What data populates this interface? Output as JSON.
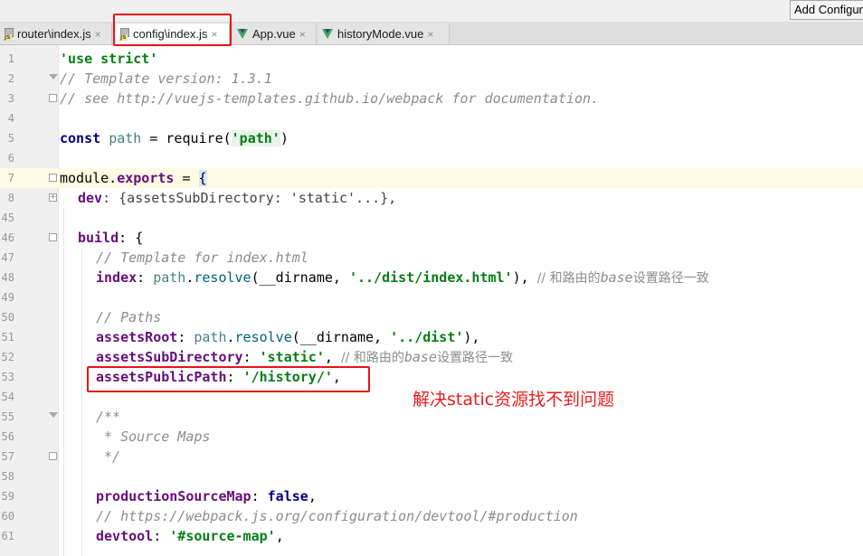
{
  "toolbar": {
    "run_config_label": "Add Configur"
  },
  "tabs": [
    {
      "label": "router\\index.js",
      "type": "js",
      "close": "×"
    },
    {
      "label": "config\\index.js",
      "type": "js",
      "close": "×"
    },
    {
      "label": "App.vue",
      "type": "vue",
      "close": "×"
    },
    {
      "label": "historyMode.vue",
      "type": "vue",
      "close": "×"
    }
  ],
  "line_numbers": [
    "1",
    "2",
    "3",
    "4",
    "5",
    "6",
    "7",
    "8",
    "45",
    "46",
    "47",
    "48",
    "49",
    "50",
    "51",
    "52",
    "53",
    "54",
    "55",
    "56",
    "57",
    "58",
    "59",
    "60",
    "61"
  ],
  "code": {
    "l1": "'use strict'",
    "l2": "// Template version: 1.3.1",
    "l3": "// see http://vuejs-templates.github.io/webpack for documentation.",
    "l5_kw": "const ",
    "l5_id": "path",
    "l5_eq": " = require(",
    "l5_str": "'path'",
    "l5_end": ")",
    "l7_a": "module.",
    "l7_b": "exports",
    "l7_c": " = ",
    "l7_d": "{",
    "l8_key": "dev",
    "l8_rest": ": {assetsSubDirectory: 'static'...},",
    "l46_key": "build",
    "l46_rest": ": {",
    "l47": "// Template for index.html",
    "l48_key": "index",
    "l48_a": ": ",
    "l48_id": "path",
    "l48_dot": ".",
    "l48_fn": "resolve",
    "l48_b": "(__dirname, ",
    "l48_str": "'../dist/index.html'",
    "l48_c": "), ",
    "l48_com1": "// 和路由的",
    "l48_com2": "base",
    "l48_com3": "设置路径一致",
    "l50": "// Paths",
    "l51_key": "assetsRoot",
    "l51_a": ": ",
    "l51_id": "path",
    "l51_dot": ".",
    "l51_fn": "resolve",
    "l51_b": "(__dirname, ",
    "l51_str": "'../dist'",
    "l51_c": "),",
    "l52_key": "assetsSubDirectory",
    "l52_a": ": ",
    "l52_str": "'static'",
    "l52_b": ", ",
    "l52_com1": "// 和路由的",
    "l52_com2": "base",
    "l52_com3": "设置路径一致",
    "l53_key": "assetsPublicPath",
    "l53_a": ": ",
    "l53_str": "'/history/'",
    "l53_b": ",",
    "l55": "/**",
    "l56": " * Source Maps",
    "l57": " */",
    "l59_key": "productionSourceMap",
    "l59_a": ": ",
    "l59_kw": "false",
    "l59_b": ",",
    "l60": "// https://webpack.js.org/configuration/devtool/#production",
    "l61_key": "devtool",
    "l61_a": ": ",
    "l61_str": "'#source-map'",
    "l61_b": ","
  },
  "annotation": "解决static资源找不到问题",
  "colors": {
    "highlight_box": "#e8141a",
    "annotation": "#ec1c1c",
    "string": "#067d17",
    "keyword": "#000080",
    "property": "#660e7a",
    "comment": "#8c8c8c"
  }
}
